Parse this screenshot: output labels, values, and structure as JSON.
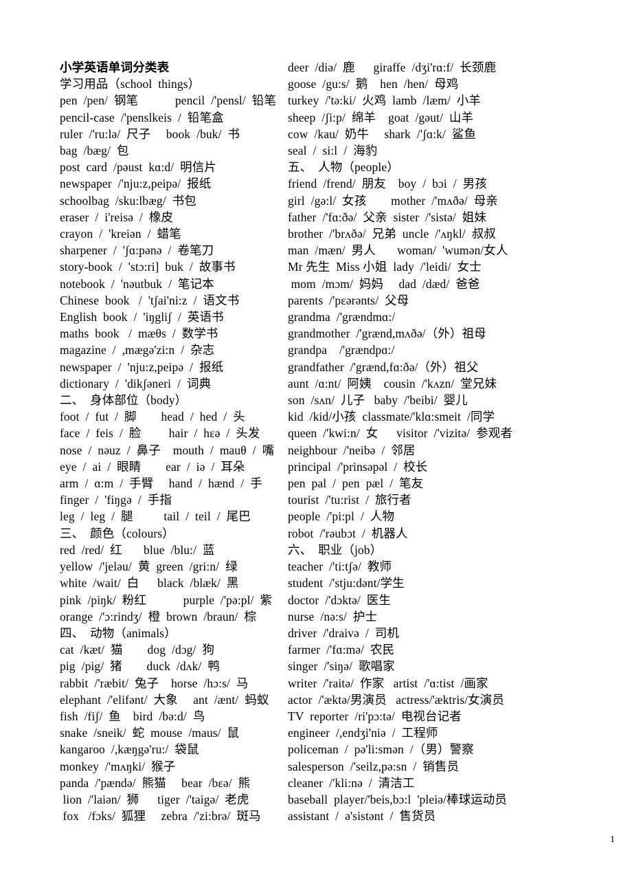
{
  "document": {
    "title": "小学英语单词分类表",
    "page_number": "1"
  },
  "left_column": {
    "lines": [
      "学习用品（school  things）",
      "pen  /pen/  钢笔            pencil  /'pensl/  铅笔",
      "pencil-case  /'penslkeis  /  铅笔盒",
      "ruler  /'ru:lə/  尺子     book  /buk/  书",
      "bag  /bæg/  包",
      "post  card  /pəust  kɑ:d/  明信片",
      "newspaper  /'nju:z,peipə/  报纸",
      "schoolbag  /sku:lbæg/  书包",
      "eraser  /  i'reisə  /  橡皮",
      "crayon  /  'kreiən  /  蜡笔",
      "sharpener  /  'ʃɑ:pənə  /  卷笔刀",
      "story-book  /  'stɔ:ri]  buk  /  故事书",
      "notebook  /  'nəutbuk  /  笔记本",
      "Chinese  book   /  'tʃai'ni:z  /  语文书",
      "English  book  /  'iŋgliʃ  /  英语书",
      "maths  book   /  mæθs  /  数学书",
      "magazine  /  ,mægə'zi:n  /  杂志",
      "newspaper  /  'nju:z,peipə  /  报纸",
      "dictionary  /  'dikʃəneri  /  词典",
      "二、  身体部位（body）",
      "foot  /  fut  /  脚        head  /  hed  /  头",
      "face  /  feis  /  脸         hair  /  hɛə  /  头发",
      "nose  /  nəuz  /  鼻子    mouth  /  mauθ  /  嘴",
      "eye  /  ai  /  眼睛        ear  /  iə  /  耳朵",
      "arm  /  ɑ:m  /  手臂     hand  /  hænd  /  手",
      "finger  /  'fiŋgə  /  手指",
      "leg  /  leg  /  腿          tail  /  teil  /  尾巴",
      "三、  颜色（colours）",
      "red  /red/  红       blue  /blu:/  蓝",
      "yellow  /'jeləu/  黄  green  /gri:n/  绿",
      "white  /wait/  白      black  /blæk/  黑",
      "pink  /piŋk/  粉红            purple  /'pə:pl/  紫",
      "orange  /'ɔ:rindʒ/  橙  brown  /braun/  棕",
      "四、  动物（animals）",
      "cat  /kæt/  猫        dog  /dɔg/  狗",
      "pig  /pig/  猪        duck  /dʌk/  鸭",
      "rabbit  /'ræbit/  兔子    horse  /hɔ:s/  马",
      "elephant  /'elifənt/  大象     ant  /ænt/  蚂蚁",
      "fish  /fiʃ/  鱼    bird  /bə:d/  鸟",
      "snake  /sneik/  蛇  mouse  /maus/  鼠",
      "kangaroo  /,kæŋgə'ru:/  袋鼠",
      "monkey  /'mʌŋki/  猴子",
      "panda  /'pændə/  熊猫     bear  /bɛə/  熊",
      " lion  /'laiən/  狮      tiger  /'taigə/  老虎",
      " fox   /fɔks/  狐狸     zebra  /'zi:brə/  斑马"
    ]
  },
  "right_column": {
    "lines": [
      "deer  /diə/  鹿      giraffe  /dʒi'rɑ:f/  长颈鹿",
      "goose  /gu:s/  鹅    hen  /hen/  母鸡",
      "turkey  /'tə:ki/  火鸡  lamb  /læm/  小羊",
      "sheep  /ʃi:p/  绵羊    goat  /gəut/  山羊",
      "cow  /kau/  奶牛     shark  /'ʃɑ:k/  鲨鱼",
      "seal  /  si:l  /  海豹",
      "五、  人物（people）",
      "friend  /frend/  朋友    boy  /  bɔi  /  男孩",
      "girl  /gə:l/  女孩        mother  /'mʌðə/  母亲",
      "father  /'fɑ:ðə/  父亲  sister  /'sistə/  姐妹",
      "brother  /'brʌðə/  兄弟  uncle  /'ʌŋkl/  叔叔",
      "man  /mæn/  男人       woman/  'wumən/女人",
      "Mr 先生  Miss 小姐  lady  /'leidi/  女士",
      " mom  /mɔm/  妈妈     dad  /dæd/  爸爸",
      "parents  /'pɛərənts/  父母",
      "grandma  /'grændmɑ:/",
      "grandmother  /'grænd,mʌðə/（外）祖母",
      "grandpa    /'grændpɑ:/",
      "grandfather  /'grænd,fɑ:ðə/（外）祖父",
      "aunt  /ɑ:nt/  阿姨    cousin  /'kʌzn/  堂兄妹",
      "son  /sʌn/  儿子   baby  /'beibi/  婴儿",
      "kid  /kid/小孩  classmate/'klɑ:smeit  /同学",
      "queen  /'kwi:n/  女      visitor  /'vizitə/  参观者",
      "neighbour  /'neibə  /  邻居",
      "principal  /'prinsəpəl  /  校长",
      "pen  pal  /  pen  pæl  /  笔友",
      "tourist  /'tu:rist  /  旅行者",
      "people  /'pi:pl  /  人物",
      "robot  /'rəubɔt  /  机器人",
      "六、  职业（job）",
      "teacher  /'ti:tʃə/  教师",
      "student  /'stju:dənt/学生",
      "doctor  /'dɔktə/  医生",
      "nurse  /nə:s/  护士",
      "driver  /'draivə  /  司机",
      "farmer  /'fɑ:mə/  农民",
      "singer  /'siŋə/  歌唱家",
      "writer  /'raitə/  作家   artist  /'ɑ:tist  /画家",
      "actor  /'æktə/男演员   actress/'æktris/女演员",
      "TV  reporter  /ri'pɔ:tə/  电视台记者",
      "engineer  /,endʒi'niə  /  工程师",
      "policeman  /  pə'li:smən  /（男）警察",
      "salesperson  /'seilz,pə:sn  /  销售员",
      "cleaner  /'kli:nə  /  清洁工",
      "baseball  player/'beis,bɔ:l  'pleiə/棒球运动员",
      "assistant  /  ə'sistənt  /  售货员"
    ]
  }
}
